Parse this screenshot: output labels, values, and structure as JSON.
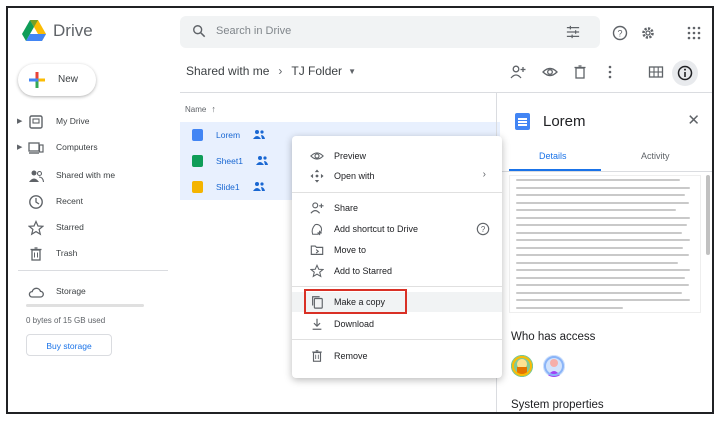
{
  "app": {
    "name": "Drive"
  },
  "search": {
    "placeholder": "Search in Drive"
  },
  "sidebar": {
    "new_label": "New",
    "items": [
      {
        "label": "My Drive",
        "icon": "my-drive-icon",
        "expandable": true
      },
      {
        "label": "Computers",
        "icon": "computers-icon",
        "expandable": true
      },
      {
        "label": "Shared with me",
        "icon": "shared-with-me-icon",
        "expandable": false
      },
      {
        "label": "Recent",
        "icon": "clock-icon",
        "expandable": false
      },
      {
        "label": "Starred",
        "icon": "star-icon",
        "expandable": false
      },
      {
        "label": "Trash",
        "icon": "trash-icon",
        "expandable": false
      }
    ],
    "storage_label": "Storage",
    "storage_used": "0 bytes of 15 GB used",
    "buy_storage": "Buy storage"
  },
  "breadcrumb": {
    "parent": "Shared with me",
    "current": "TJ Folder"
  },
  "list": {
    "column_header": "Name",
    "files": [
      {
        "name": "Lorem",
        "type": "docs",
        "color": "#4285f4"
      },
      {
        "name": "Sheet1",
        "type": "sheets",
        "color": "#0f9d58"
      },
      {
        "name": "Slide1",
        "type": "slides",
        "color": "#f4b400"
      }
    ]
  },
  "context_menu": {
    "items": [
      {
        "label": "Preview",
        "icon": "eye-icon"
      },
      {
        "label": "Open with",
        "icon": "move-icon",
        "submenu": true
      },
      {
        "label": "Share",
        "icon": "person-add-icon"
      },
      {
        "label": "Add shortcut to Drive",
        "icon": "add-shortcut-icon",
        "help": true
      },
      {
        "label": "Move to",
        "icon": "folder-move-icon"
      },
      {
        "label": "Add to Starred",
        "icon": "star-icon"
      },
      {
        "label": "Make a copy",
        "icon": "copy-icon",
        "highlighted": true
      },
      {
        "label": "Download",
        "icon": "download-icon"
      },
      {
        "label": "Remove",
        "icon": "trash-icon"
      }
    ],
    "highlight_color": "#d93025"
  },
  "details": {
    "title": "Lorem",
    "tabs": [
      "Details",
      "Activity"
    ],
    "active_tab": "Details",
    "who_has_access": "Who has access",
    "system_properties": "System properties"
  },
  "colors": {
    "accent": "#1a73e8",
    "selected_row": "#e8f0fe"
  }
}
